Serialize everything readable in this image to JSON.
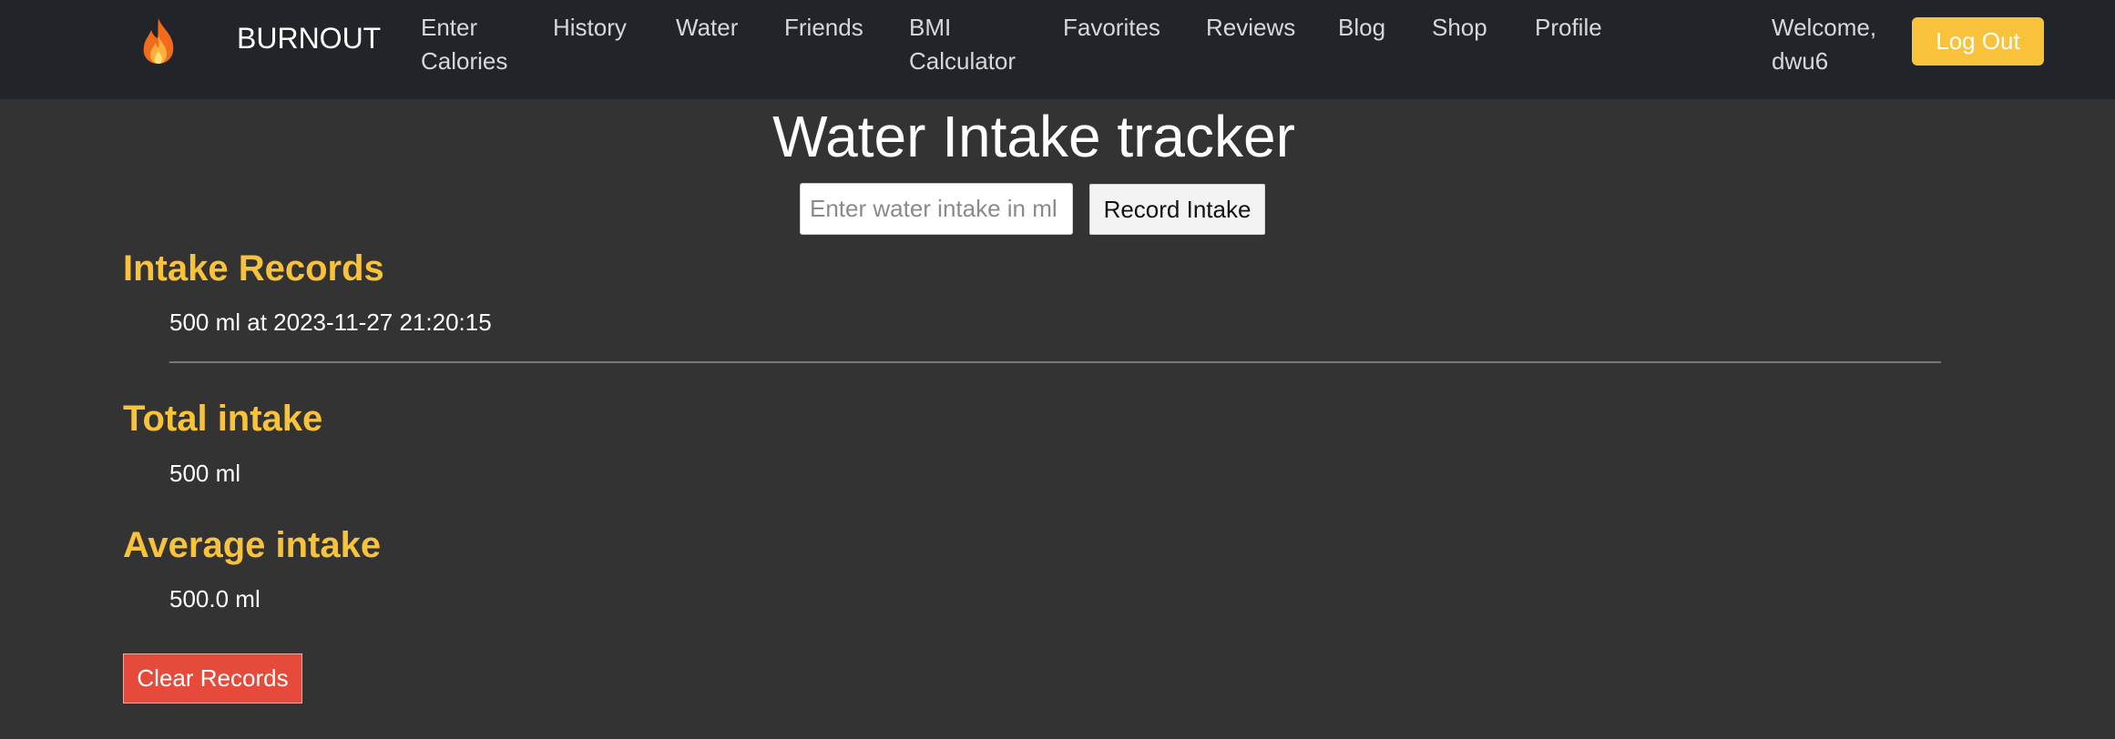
{
  "nav": {
    "logo_icon": "fire-icon",
    "brand": "BURNOUT",
    "links": [
      {
        "line1": "Enter",
        "line2": "Calories"
      },
      {
        "line1": "History",
        "line2": ""
      },
      {
        "line1": "Water",
        "line2": ""
      },
      {
        "line1": "Friends",
        "line2": ""
      },
      {
        "line1": "BMI",
        "line2": "Calculator"
      },
      {
        "line1": "Favorites",
        "line2": ""
      },
      {
        "line1": "Reviews",
        "line2": ""
      },
      {
        "line1": "Blog",
        "line2": ""
      },
      {
        "line1": "Shop",
        "line2": ""
      },
      {
        "line1": "Profile",
        "line2": ""
      }
    ],
    "welcome_line1": "Welcome,",
    "welcome_line2": "dwu6",
    "logout_label": "Log Out"
  },
  "main": {
    "title": "Water Intake tracker",
    "input_placeholder": "Enter water intake in ml",
    "input_value": "",
    "record_label": "Record Intake",
    "records_heading": "Intake Records",
    "records": [
      "500 ml at 2023-11-27 21:20:15"
    ],
    "total_heading": "Total intake",
    "total_value": "500 ml",
    "average_heading": "Average intake",
    "average_value": "500.0 ml",
    "clear_label": "Clear Records"
  },
  "colors": {
    "navbar_bg": "#212529",
    "page_bg": "#333333",
    "accent_yellow": "#f8c23a",
    "danger_red": "#e64a3b"
  }
}
